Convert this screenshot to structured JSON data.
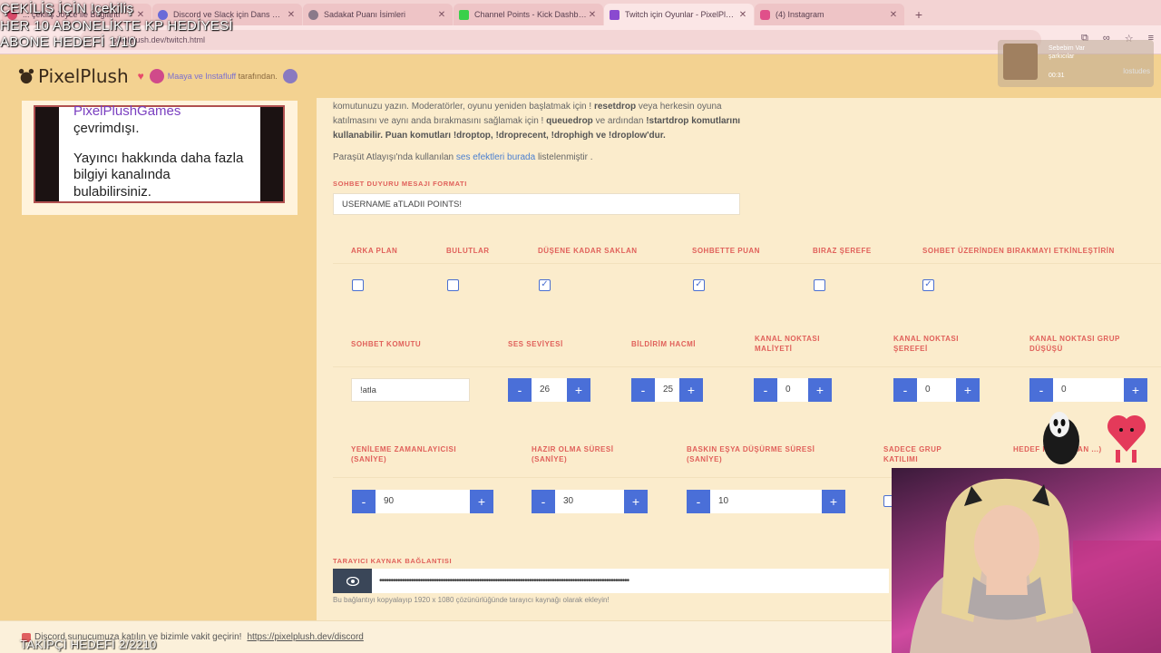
{
  "browser": {
    "tabs": [
      {
        "label": "... çekiliş Joyce ile Bağlantı",
        "color": "#d84a6a",
        "active": false
      },
      {
        "label": "Discord ve Slack için Dans Emo",
        "color": "#6a6ad8",
        "active": false
      },
      {
        "label": "Sadakat Puanı İsimleri",
        "color": "#8a7a8a",
        "active": false
      },
      {
        "label": "Channel Points - Kick Dashboa",
        "color": "#3ad04a",
        "active": false
      },
      {
        "label": "Twitch için Oyunlar - PixelPlush",
        "color": "#8a4ad0",
        "active": true
      },
      {
        "label": "(4) Instagram",
        "color": "#e0508a",
        "active": false
      }
    ],
    "url": "pixelplush.dev/twitch.html"
  },
  "overlays": {
    "line1": "ÇEKİLİŞ İÇİN !çekiliş",
    "line2": "HER 10 ABONELİKTE KP HEDİYESİ",
    "line3": "ABONE HEDEFİ 1/10",
    "bottom": "TAKİPÇİ HEDEFİ 2/2210"
  },
  "site": {
    "logo": "PixelPlush",
    "maker_names": "Maaya ve Instafluff",
    "maker_suffix": "tarafından."
  },
  "spotify": {
    "title": "Sebebim Var",
    "artist": "şarkıcılar",
    "time": "00:31",
    "badge": "lostudes"
  },
  "sidebar": {
    "channel": "PixelPlushGames",
    "offline": "çevrimdışı.",
    "more_info": "Yayıncı hakkında daha fazla bilgiyi kanalında bulabilirsiniz."
  },
  "main": {
    "instr_1": "komutunuzu yazın. Moderatörler, oyunu yeniden başlatmak için !",
    "instr_resetdrop": "resetdrop",
    "instr_2": "veya herkesin oyuna katılmasını ve aynı anda bırakmasını sağlamak için !",
    "instr_queuedrop": "queuedrop",
    "instr_3": "ve ardından",
    "instr_startdrop": "!startdrop komutlarını kullanabilir. Puan komutları !droptop, !droprecent, !drophigh ve !droplow'dur.",
    "para_1": "Paraşüt Atlayışı'nda kullanılan",
    "para_link": "ses efektleri burada",
    "para_2": "listelenmiştir .",
    "chat_format_label": "SOHBET DUYURU MESAJI FORMATI",
    "chat_format_value": "USERNAME aTLADII POINTS!",
    "checkbox_row": [
      {
        "label": "ARKA PLAN",
        "checked": false
      },
      {
        "label": "BULUTLAR",
        "checked": false
      },
      {
        "label": "DÜŞENE KADAR SAKLAN",
        "checked": true
      },
      {
        "label": "SOHBETTE PUAN",
        "checked": true
      },
      {
        "label": "BIRAZ ŞEREFE",
        "checked": false
      },
      {
        "label": "SOHBET ÜZERİNDEN BIRAKMAYI ETKİNLEŞTİRİN",
        "checked": true
      }
    ],
    "row2": {
      "command_label": "SOHBET KOMUTU",
      "command_value": "!atla",
      "volume_label": "SES SEVİYESİ",
      "volume_value": "26",
      "notify_label": "BİLDİRİM HACMİ",
      "notify_value": "25",
      "cost_label": "KANAL NOKTASI MALİYETİ",
      "cost_value": "0",
      "honor_label": "KANAL NOKTASI ŞEREFEİ",
      "honor_value": "0",
      "group_label": "KANAL NOKTASI GRUP DÜŞÜŞÜ",
      "group_value": "0"
    },
    "row3": {
      "refresh_label": "YENİLEME ZAMANLAYICISI (SANİYE)",
      "refresh_value": "90",
      "ready_label": "HAZIR OLMA SÜRESİ (SANİYE)",
      "ready_value": "30",
      "raid_label": "BASKIN EŞYA DÜŞÜRME SÜRESİ (SANİYE)",
      "raid_value": "10",
      "group_only_label": "SADECE GRUP KATILIMI",
      "target_label": "HEDEF K... (EKRAN ...)"
    },
    "source_label": "TARAYICI KAYNAK BAĞLANTISI",
    "source_mask": "••••••••••••••••••••••••••••••••••••••••••••••••••••••••••••••••••••••••••••••••••••••••••••••••••••••••••••••",
    "source_hint": "Bu bağlantıyı kopyalayıp 1920 x 1080 çözünürlüğünde tarayıcı kaynağı olarak ekleyin!"
  },
  "footer": {
    "text": "Discord sunucumuza katılın ve bizimle vakit geçirin!",
    "link": "https://pixelplush.dev/discord"
  }
}
